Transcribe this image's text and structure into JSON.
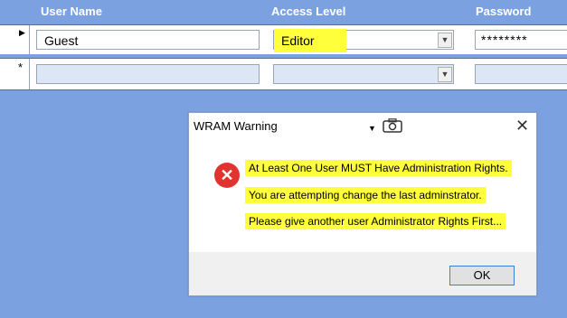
{
  "columns": {
    "user_name": "User Name",
    "access_level": "Access Level",
    "password": "Password"
  },
  "rows": [
    {
      "selector": "▶",
      "user_name": "Guest",
      "access_level": "Editor",
      "password": "********"
    },
    {
      "selector": "*",
      "user_name": "",
      "access_level": "",
      "password": ""
    }
  ],
  "dialog": {
    "title": "WRAM Warning",
    "close_glyph": "✕",
    "messages": [
      "At Least One User MUST Have Administration Rights.",
      "You are attempting change the last adminstrator.",
      "Please give another user Administrator Rights First..."
    ],
    "ok_label": "OK",
    "icon": "error-x-icon"
  },
  "colors": {
    "background": "#7ba1e0",
    "highlight": "#ffff3b",
    "error": "#e2342e"
  }
}
